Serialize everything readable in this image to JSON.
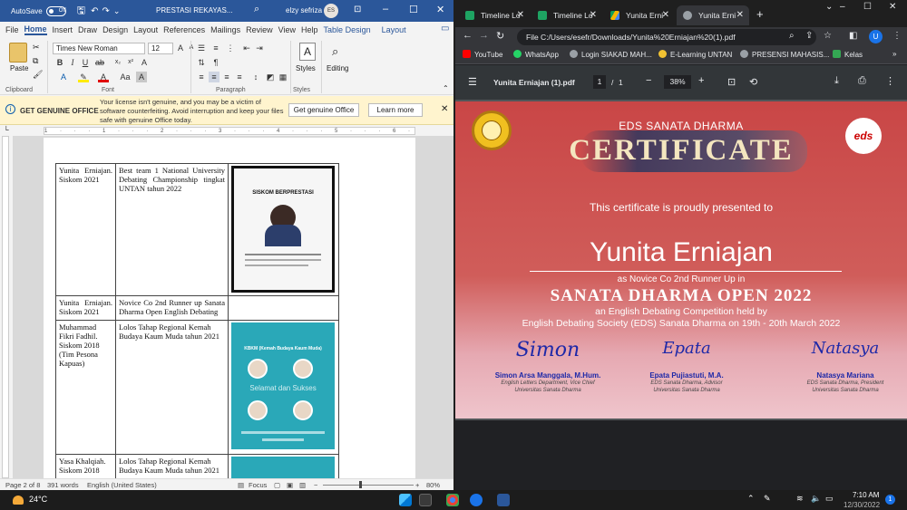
{
  "word": {
    "title_bar": {
      "autosave_label": "AutoSave",
      "autosave_state": "Off",
      "doc_title": "PRESTASI REKAYAS...",
      "user_name": "elzy sefriza",
      "user_initials": "ES"
    },
    "tabs": [
      "File",
      "Home",
      "Insert",
      "Draw",
      "Design",
      "Layout",
      "References",
      "Mailings",
      "Review",
      "View",
      "Help",
      "Table Design",
      "Layout"
    ],
    "ribbon": {
      "paste_label": "Paste",
      "font_name": "Times New Roman",
      "font_size": "12",
      "styles_label": "Styles",
      "editing_label": "Editing",
      "groups": {
        "clipboard": "Clipboard",
        "font": "Font",
        "paragraph": "Paragraph",
        "styles": "Styles"
      }
    },
    "banner": {
      "title": "GET GENUINE OFFICE",
      "message": "Your license isn't genuine, and you may be a victim of software counterfeiting. Avoid interruption and keep your files safe with genuine Office today.",
      "primary_button": "Get genuine Office",
      "secondary_button": "Learn more"
    },
    "ruler_marks": "1 · · · 1 · · · 2 · · · 3 · · · 4 · · · 5 · · · 6 · · · 7",
    "table_rows": [
      {
        "name": "Yunita Erniajan. Siskom 2021",
        "achievement": "Best team 1 National University Debating Championship tingkat UNTAN tahun 2022",
        "poster_heading": "SISKOM BERPRESTASI"
      },
      {
        "name": "Yunita Erniajan. Siskom 2021",
        "achievement": "Novice Co 2nd Runner up Sanata Dharma Open English Debating"
      },
      {
        "name": "Muhammad Fikri Fadhil. Siskom 2018 (Tim Pesona Kapuas)",
        "achievement": "Lolos Tahap Regional Kemah Budaya Kaum Muda tahun 2021",
        "poster_heading": "KBKM (Kemah Budaya Kaum Muda)",
        "poster_sub": "Selamat dan Sukses"
      },
      {
        "name": "Yasa Khalqiah. Siskom 2018",
        "achievement": "Lolos Tahap Regional Kemah Budaya Kaum Muda tahun 2021"
      }
    ],
    "status": {
      "page": "Page 2 of 8",
      "words": "391 words",
      "language": "English (United States)",
      "focus": "Focus",
      "zoom": "80%"
    }
  },
  "chrome": {
    "tabs": [
      {
        "label": "Timeline Lo",
        "color": "#1ea362"
      },
      {
        "label": "Timeline Lo",
        "color": "#1ea362"
      },
      {
        "label": "Yunita Erni",
        "color": "#f4b400"
      },
      {
        "label": "Yunita Erni",
        "color": "#9aa0a6"
      }
    ],
    "url": "File  C:/Users/esefr/Downloads/Yunita%20Erniajan%20(1).pdf",
    "profile_initial": "U",
    "bookmarks": [
      "YouTube",
      "WhatsApp",
      "Login SIAKAD MAH...",
      "E-Learning UNTAN",
      "PRESENSI MAHASIS...",
      "Kelas"
    ],
    "pdf": {
      "filename": "Yunita Erniajan (1).pdf",
      "page_current": "1",
      "page_total": "1",
      "zoom": "38%"
    },
    "certificate": {
      "org": "EDS SANATA DHARMA",
      "heading": "CERTIFICATE",
      "presented": "This certificate is proudly presented to",
      "recipient": "Yunita Erniajan",
      "as_line": "as Novice Co 2nd Runner Up in",
      "event": "SANATA DHARMA OPEN 2022",
      "desc1": "an English Debating Competition held by",
      "desc2": "English Debating Society (EDS) Sanata Dharma on 19th - 20th March 2022",
      "logo_text": "eds",
      "signatures": [
        {
          "name": "Simon Arsa Manggala, M.Hum.",
          "role1": "English Letters Department, Vice Chief",
          "role2": "Universitas Sanata Dharma",
          "script": "Simon"
        },
        {
          "name": "Epata Pujiastuti, M.A.",
          "role1": "EDS Sanata Dharma, Advisor",
          "role2": "Universitas Sanata Dharma",
          "script": "Epata"
        },
        {
          "name": "Natasya Mariana",
          "role1": "EDS Sanata Dharma, President",
          "role2": "Universitas Sanata Dharma",
          "script": "Natasya"
        }
      ]
    }
  },
  "taskbar": {
    "temperature": "24°C",
    "time": "7:10 AM",
    "date": "12/30/2022",
    "notification_count": "1"
  }
}
